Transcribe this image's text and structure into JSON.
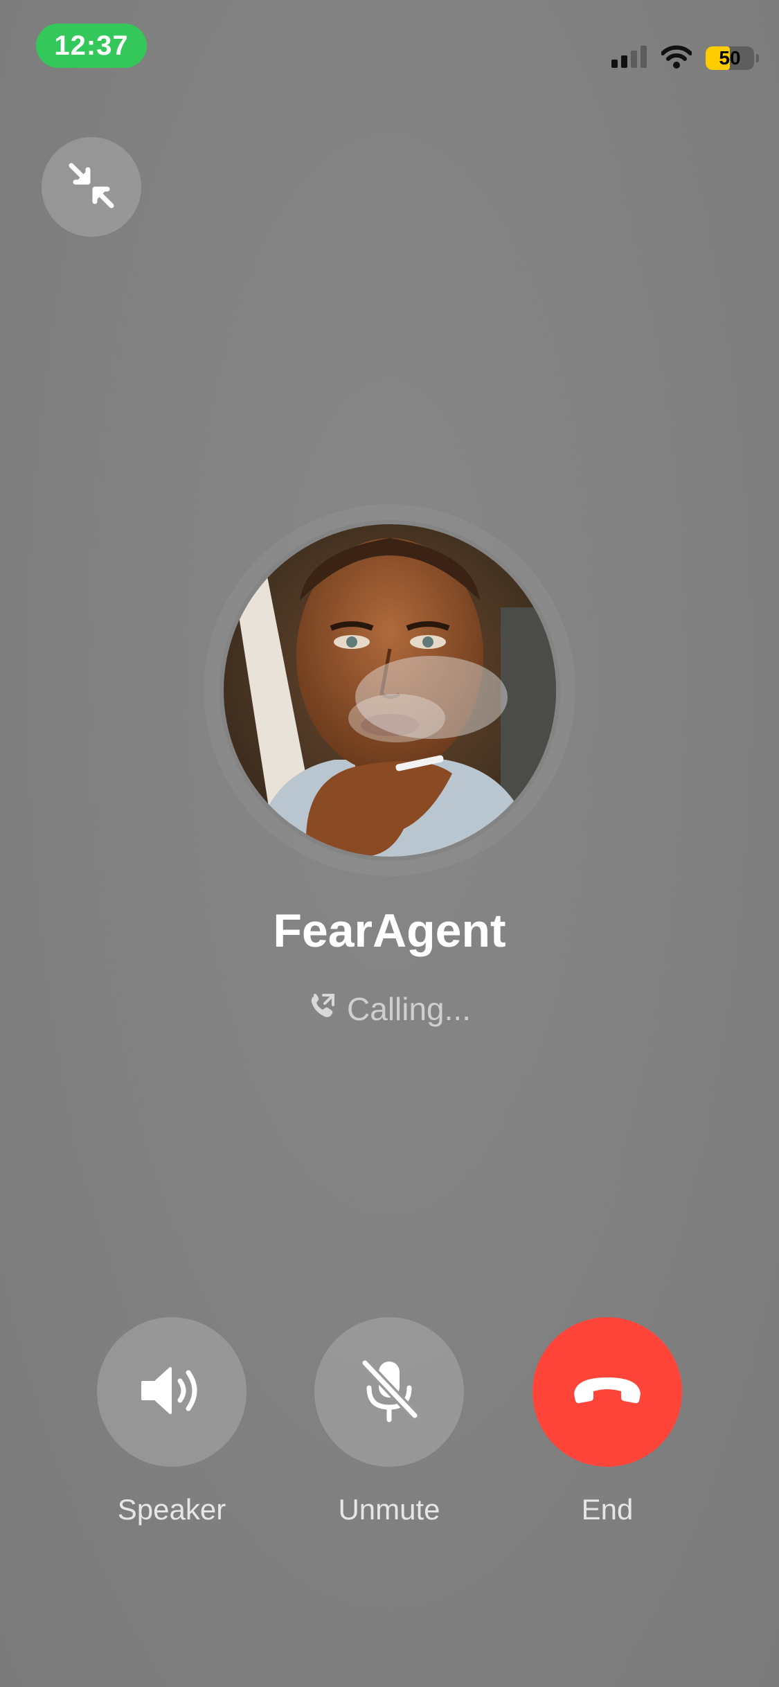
{
  "status_bar": {
    "time": "12:37",
    "battery_percent": "50",
    "battery_level": 0.5,
    "signal_icon": "cellular-signal-icon",
    "wifi_icon": "wifi-icon",
    "time_pill_color": "#34c759",
    "battery_color": "#ffcc00"
  },
  "minimize": {
    "icon": "minimize-arrows-icon"
  },
  "contact": {
    "name": "FearAgent",
    "avatar": "contact-photo"
  },
  "call": {
    "status_icon": "outgoing-call-icon",
    "status_text": "Calling..."
  },
  "controls": [
    {
      "id": "speaker",
      "label": "Speaker",
      "icon": "speaker-icon"
    },
    {
      "id": "unmute",
      "label": "Unmute",
      "icon": "microphone-muted-icon"
    },
    {
      "id": "end",
      "label": "End",
      "icon": "end-call-icon",
      "color": "#ff453a"
    }
  ]
}
